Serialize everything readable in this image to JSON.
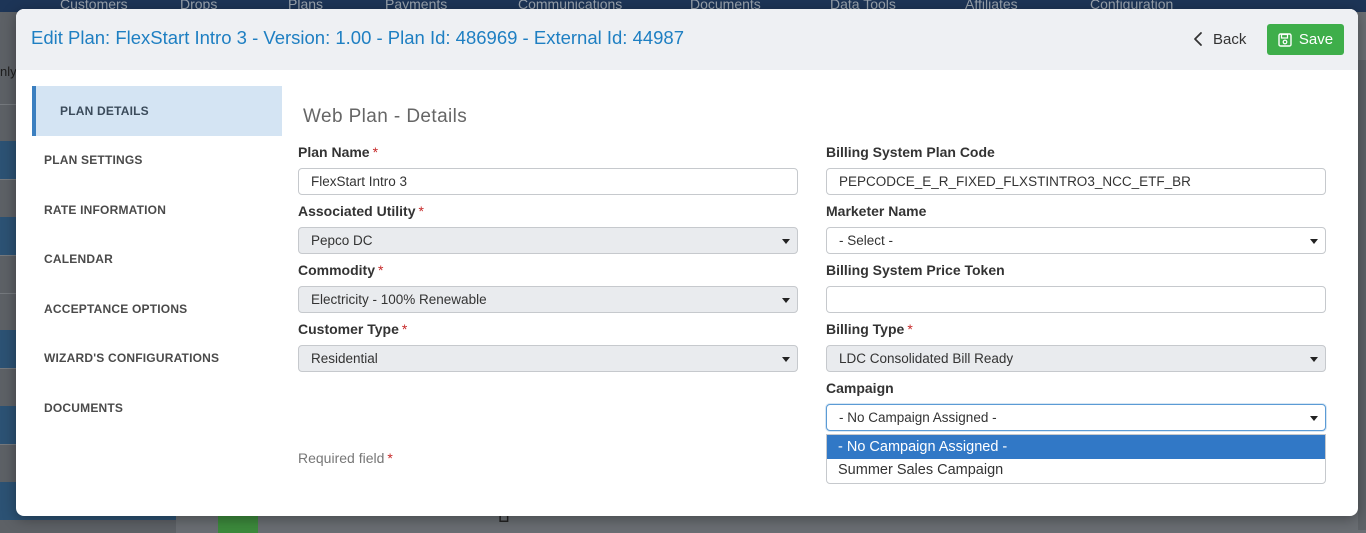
{
  "background": {
    "nav_items": [
      "Customers",
      "Drops",
      "Plans",
      "Payments",
      "Communications",
      "Documents",
      "Data Tools",
      "Affiliates",
      "Configuration"
    ],
    "sidebar_fragment": "nly"
  },
  "modal": {
    "title": "Edit Plan: FlexStart Intro 3 - Version: 1.00 - Plan Id: 486969 - External Id: 44987",
    "back_label": "Back",
    "save_label": "Save"
  },
  "sidebar": {
    "items": [
      {
        "label": "PLAN DETAILS",
        "active": true
      },
      {
        "label": "PLAN SETTINGS",
        "active": false
      },
      {
        "label": "RATE INFORMATION",
        "active": false
      },
      {
        "label": "CALENDAR",
        "active": false
      },
      {
        "label": "ACCEPTANCE OPTIONS",
        "active": false
      },
      {
        "label": "WIZARD'S CONFIGURATIONS",
        "active": false
      },
      {
        "label": "DOCUMENTS",
        "active": false
      }
    ]
  },
  "form": {
    "section_title": "Web Plan - Details",
    "required_marker": "*",
    "plan_name": {
      "label": "Plan Name",
      "value": "FlexStart Intro 3"
    },
    "associated_utility": {
      "label": "Associated Utility",
      "value": "Pepco DC"
    },
    "commodity": {
      "label": "Commodity",
      "value": "Electricity - 100% Renewable"
    },
    "customer_type": {
      "label": "Customer Type",
      "value": "Residential"
    },
    "billing_system_plan_code": {
      "label": "Billing System Plan Code",
      "value": "PEPCODCE_E_R_FIXED_FLXSTINTRO3_NCC_ETF_BR"
    },
    "marketer_name": {
      "label": "Marketer Name",
      "value": "- Select -"
    },
    "billing_system_price_token": {
      "label": "Billing System Price Token",
      "value": ""
    },
    "billing_type": {
      "label": "Billing Type",
      "value": "LDC Consolidated Bill Ready"
    },
    "campaign": {
      "label": "Campaign",
      "value": "- No Campaign Assigned -",
      "options": [
        "- No Campaign Assigned -",
        "Summer Sales Campaign"
      ],
      "highlighted": "- No Campaign Assigned -"
    },
    "required_note": "Required field"
  },
  "colors": {
    "title_blue": "#1e7fc2",
    "save_green": "#3eae4a",
    "active_nav_bg": "#d4e4f3",
    "required_red": "#c62828",
    "selected_option": "#3178c6"
  }
}
